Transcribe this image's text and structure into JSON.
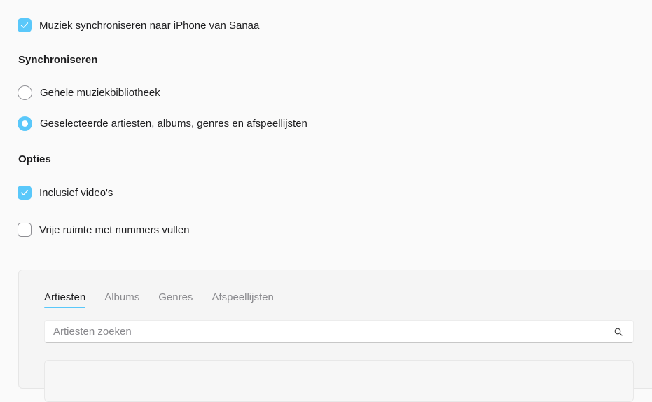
{
  "sync_music": {
    "label": "Muziek synchroniseren naar iPhone van Sanaa",
    "checked": true
  },
  "sync_section": {
    "heading": "Synchroniseren",
    "options": [
      {
        "label": "Gehele muziekbibliotheek",
        "selected": false
      },
      {
        "label": "Geselecteerde artiesten, albums, genres en afspeellijsten",
        "selected": true
      }
    ]
  },
  "options_section": {
    "heading": "Opties",
    "items": [
      {
        "label": "Inclusief video's",
        "checked": true
      },
      {
        "label": "Vrije ruimte met nummers vullen",
        "checked": false
      }
    ]
  },
  "browser": {
    "tabs": [
      {
        "label": "Artiesten",
        "active": true
      },
      {
        "label": "Albums",
        "active": false
      },
      {
        "label": "Genres",
        "active": false
      },
      {
        "label": "Afspeellijsten",
        "active": false
      }
    ],
    "search": {
      "placeholder": "Artiesten zoeken",
      "value": "",
      "icon": "search-icon"
    }
  },
  "colors": {
    "accent": "#5ac8fa",
    "background": "#fafafa",
    "text": "#1d1d1f",
    "secondary_text": "#8a8a8e"
  }
}
